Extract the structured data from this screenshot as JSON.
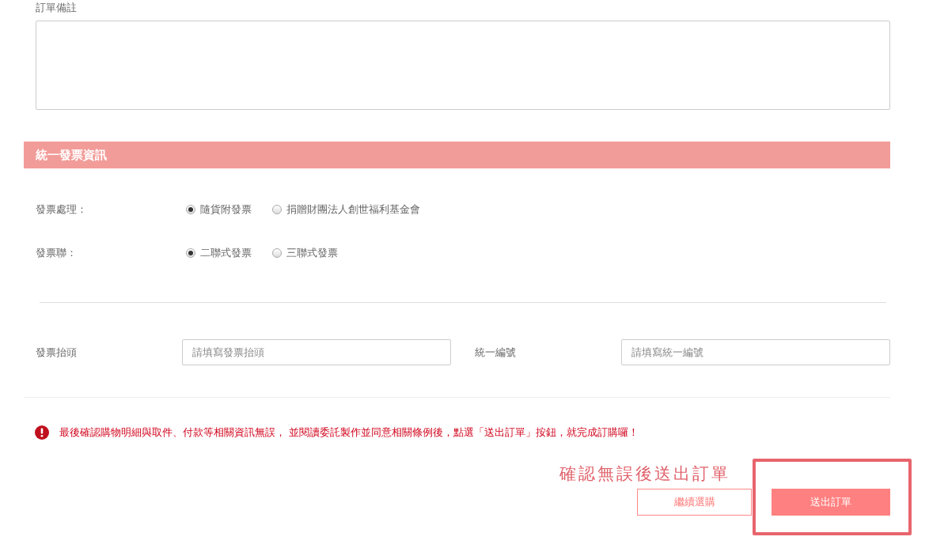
{
  "remarks": {
    "label": "訂單備註"
  },
  "section_title": "統一發票資訊",
  "radio_groups": [
    {
      "label": "發票處理：",
      "options": [
        {
          "label": "隨貨附發票",
          "selected": true
        },
        {
          "label": "捐贈財團法人創世福利基金會",
          "selected": false
        }
      ]
    },
    {
      "label": "發票聯：",
      "options": [
        {
          "label": "二聯式發票",
          "selected": true
        },
        {
          "label": "三聯式發票",
          "selected": false
        }
      ]
    }
  ],
  "fields": [
    {
      "label": "發票抬頭",
      "placeholder": "請填寫發票抬頭"
    },
    {
      "label": "統一編號",
      "placeholder": "請填寫統一編號"
    }
  ],
  "notice": {
    "text": "最後確認購物明細與取件、付款等相關資訊無誤， 並閱讀委託製作並同意相關條例後，點選「送出訂單」按鈕，就完成訂購囉！"
  },
  "annotation": {
    "text": "確認無誤後送出訂單"
  },
  "buttons": [
    {
      "label": "繼續選購",
      "kind": "secondary"
    },
    {
      "label": "送出訂單",
      "kind": "primary"
    }
  ]
}
